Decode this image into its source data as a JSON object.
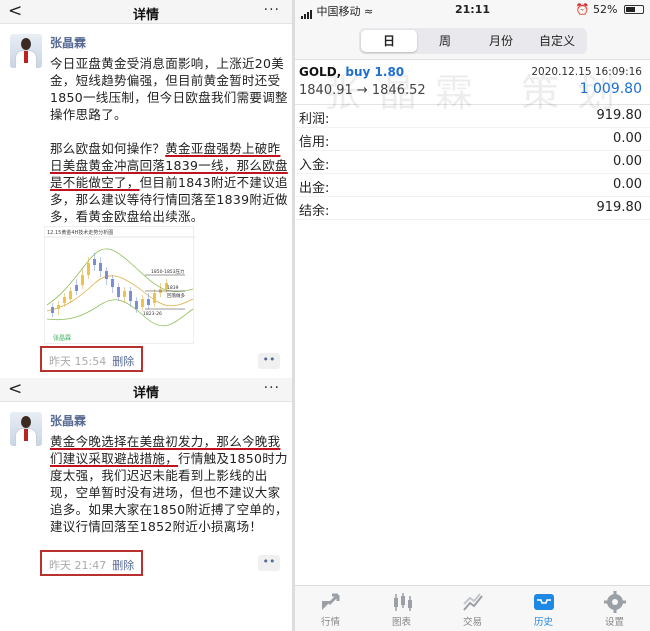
{
  "post1": {
    "nav_title": "详情",
    "back": "<",
    "more": "···",
    "author": "张晶霖",
    "para1": "今日亚盘黄金受消息面影响，上涨近20美金，短线趋势偏强，但目前黄金暂时还受1850一线压制，但今日欧盘我们需要调整操作思路了。",
    "para2_plain": "那么欧盘如何操作？",
    "para2_hl": "黄金亚盘强势上破昨日美盘黄金冲高回落1839一线，那么欧盘是不能做空了，",
    "para2_tail": "但目前1843附近不建议追多，那么建议等待行情回落至1839附近做多，看黄金欧盘给出续涨。",
    "chart_caption": "12.15黄金4H技术走势分析图",
    "chart_label1": "1850-1853压力",
    "chart_label2": "1839",
    "chart_label3": "回落做多",
    "chart_label4": "1823-26",
    "chart_sig": "张晶霖",
    "time": "昨天 15:54",
    "delete": "删除",
    "dots": "••"
  },
  "post2": {
    "nav_title": "详情",
    "back": "<",
    "more": "···",
    "author": "张晶霖",
    "hl": "黄金今晚选择在美盘初发力，那么今晚我们建议采取避战措施，",
    "text": "行情触及1850时力度太强，我们迟迟未能看到上影线的出现，空单暂时没有进场，但也不建议大家追多。如果大家在1850附近搏了空单的，建议行情回落至1852附近小损离场！",
    "time": "昨天 21:47",
    "delete": "删除",
    "dots": "••"
  },
  "mt4": {
    "status": {
      "carrier": "中国移动",
      "time": "21:11",
      "battery": "52%"
    },
    "tabs": [
      "日",
      "周",
      "月份",
      "自定义"
    ],
    "active_tab": "日",
    "trade": {
      "symbol": "GOLD,",
      "side": "buy 1.80",
      "time": "2020.12.15 16:09:16",
      "prices": "1840.91 → 1846.52",
      "profit": "1 009.80"
    },
    "watermark": "张晶霖 策划",
    "summary": [
      {
        "k": "利润:",
        "v": "919.80"
      },
      {
        "k": "信用:",
        "v": "0.00"
      },
      {
        "k": "入金:",
        "v": "0.00"
      },
      {
        "k": "出金:",
        "v": "0.00"
      },
      {
        "k": "结余:",
        "v": "919.80"
      }
    ],
    "bottom_tabs": [
      {
        "label": "行情",
        "icon": "quotes-icon"
      },
      {
        "label": "图表",
        "icon": "chart-icon"
      },
      {
        "label": "交易",
        "icon": "trade-icon"
      },
      {
        "label": "历史",
        "icon": "history-icon"
      },
      {
        "label": "设置",
        "icon": "settings-icon"
      }
    ],
    "active_bottom": "历史",
    "accent": "#1e88e5"
  }
}
